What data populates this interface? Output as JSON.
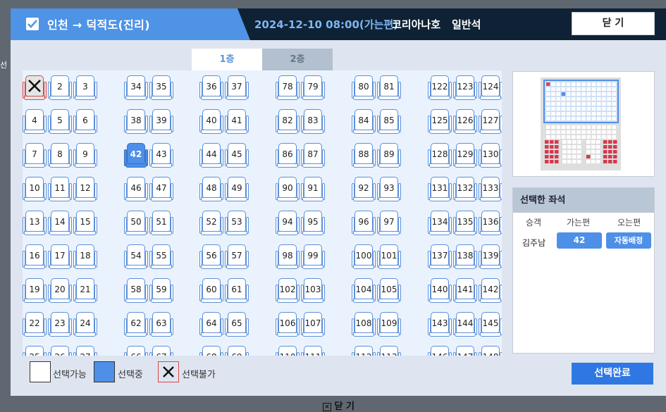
{
  "header": {
    "route": "인천 → 덕적도(진리)",
    "datetime": "2024-12-10 08:00(가는편)",
    "ship": "코리아나호",
    "seat_class": "일반석",
    "close_label": "닫 기"
  },
  "deck_tabs": [
    {
      "label": "1층",
      "active": true
    },
    {
      "label": "2층",
      "active": false
    }
  ],
  "seats": {
    "unavailable": [
      1
    ],
    "selected": [
      42
    ],
    "columns": [
      [
        1,
        4,
        7,
        10,
        13,
        16,
        19,
        22
      ],
      [
        2,
        5,
        8,
        11,
        14,
        17,
        20,
        23
      ],
      [
        3,
        6,
        9,
        12,
        15,
        18,
        21,
        24
      ],
      [
        34,
        38,
        42,
        46,
        50,
        54,
        58,
        62
      ],
      [
        35,
        39,
        43,
        47,
        51,
        55,
        59,
        63
      ],
      [
        36,
        40,
        44,
        48,
        52,
        56,
        60,
        64
      ],
      [
        37,
        41,
        45,
        49,
        53,
        57,
        61,
        65
      ],
      [
        78,
        82,
        86,
        90,
        94,
        98,
        102,
        106
      ],
      [
        79,
        83,
        87,
        91,
        95,
        99,
        103,
        107
      ],
      [
        80,
        84,
        88,
        92,
        96,
        100,
        104,
        108
      ],
      [
        81,
        85,
        89,
        93,
        97,
        101,
        105,
        109
      ],
      [
        122,
        125,
        128,
        131,
        134,
        137,
        140,
        143
      ],
      [
        123,
        126,
        129,
        132,
        135,
        138,
        141,
        144
      ],
      [
        124,
        127,
        130,
        133,
        136,
        139,
        142,
        145
      ]
    ]
  },
  "legend": {
    "available": "선택가능",
    "selected": "선택중",
    "unavailable": "선택불가"
  },
  "selected_panel": {
    "title": "선택한 좌석",
    "headers": {
      "passenger": "승객",
      "outbound": "가는편",
      "return": "오는편"
    },
    "rows": [
      {
        "passenger": "김주남",
        "outbound": "42",
        "return": "자동배정"
      }
    ]
  },
  "confirm_label": "선택완료",
  "bottom_close_label": "닫 기",
  "colors": {
    "header_bg": "#0f2235",
    "route_tab": "#4e93e6",
    "selected_seat": "#4e8fe8",
    "unavailable_border": "#d84848",
    "confirm_btn": "#2f78e3"
  }
}
